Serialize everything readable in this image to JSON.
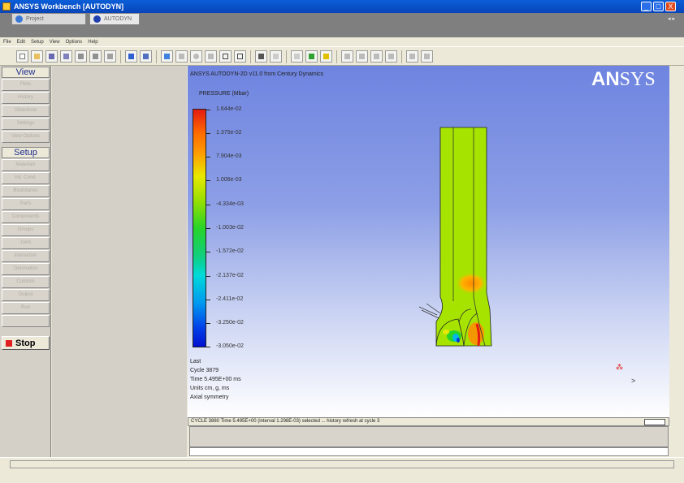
{
  "window": {
    "title": "ANSYS Workbench [AUTODYN]",
    "min_glyph": "_",
    "max_glyph": "□",
    "close_glyph": "X"
  },
  "tabs": [
    {
      "label": "Project",
      "icon": "workbench-icon",
      "active": false
    },
    {
      "label": "AUTODYN",
      "icon": "autodyn-icon",
      "active": true
    }
  ],
  "tab_arrows": "◂ ▸",
  "menu": [
    "File",
    "Edit",
    "Setup",
    "View",
    "Options",
    "Help"
  ],
  "left_panel": {
    "view_heading": "View",
    "view_items": [
      "Plots",
      "History",
      "Slideshow",
      "Settings",
      "View Options"
    ],
    "setup_heading": "Setup",
    "setup_items": [
      "Materials",
      "Init. Cond.",
      "Boundaries",
      "Parts",
      "Components",
      "Groups",
      "Joins",
      "Interaction",
      "Detonation",
      "Controls",
      "Output",
      "Run"
    ],
    "stop_label": "Stop"
  },
  "viewport": {
    "title": "ANSYS AUTODYN-2D v11.0 from Century Dynamics",
    "logo_an": "AN",
    "logo_sys": "SYS",
    "legend_title": "PRESSURE (Mbar)",
    "legend_labels": [
      "1.644e-02",
      "1.375e-02",
      "7.904e-03",
      "1.006e-03",
      "-4.334e-03",
      "-1.003e-02",
      "-1.572e-02",
      "-2.137e-02",
      "-2.411e-02",
      "-3.250e-02",
      "-3.050e-02"
    ],
    "info_lines": [
      "Last",
      "Cycle 3879",
      "Time 5.495E+00 ms",
      "Units cm, g, ms",
      "Axial symmetry"
    ]
  },
  "message_bar": "CYCLE 3880 Time 5.495E+00 (interval 1.298E-03) selected ... history refresh at cycle 3"
}
